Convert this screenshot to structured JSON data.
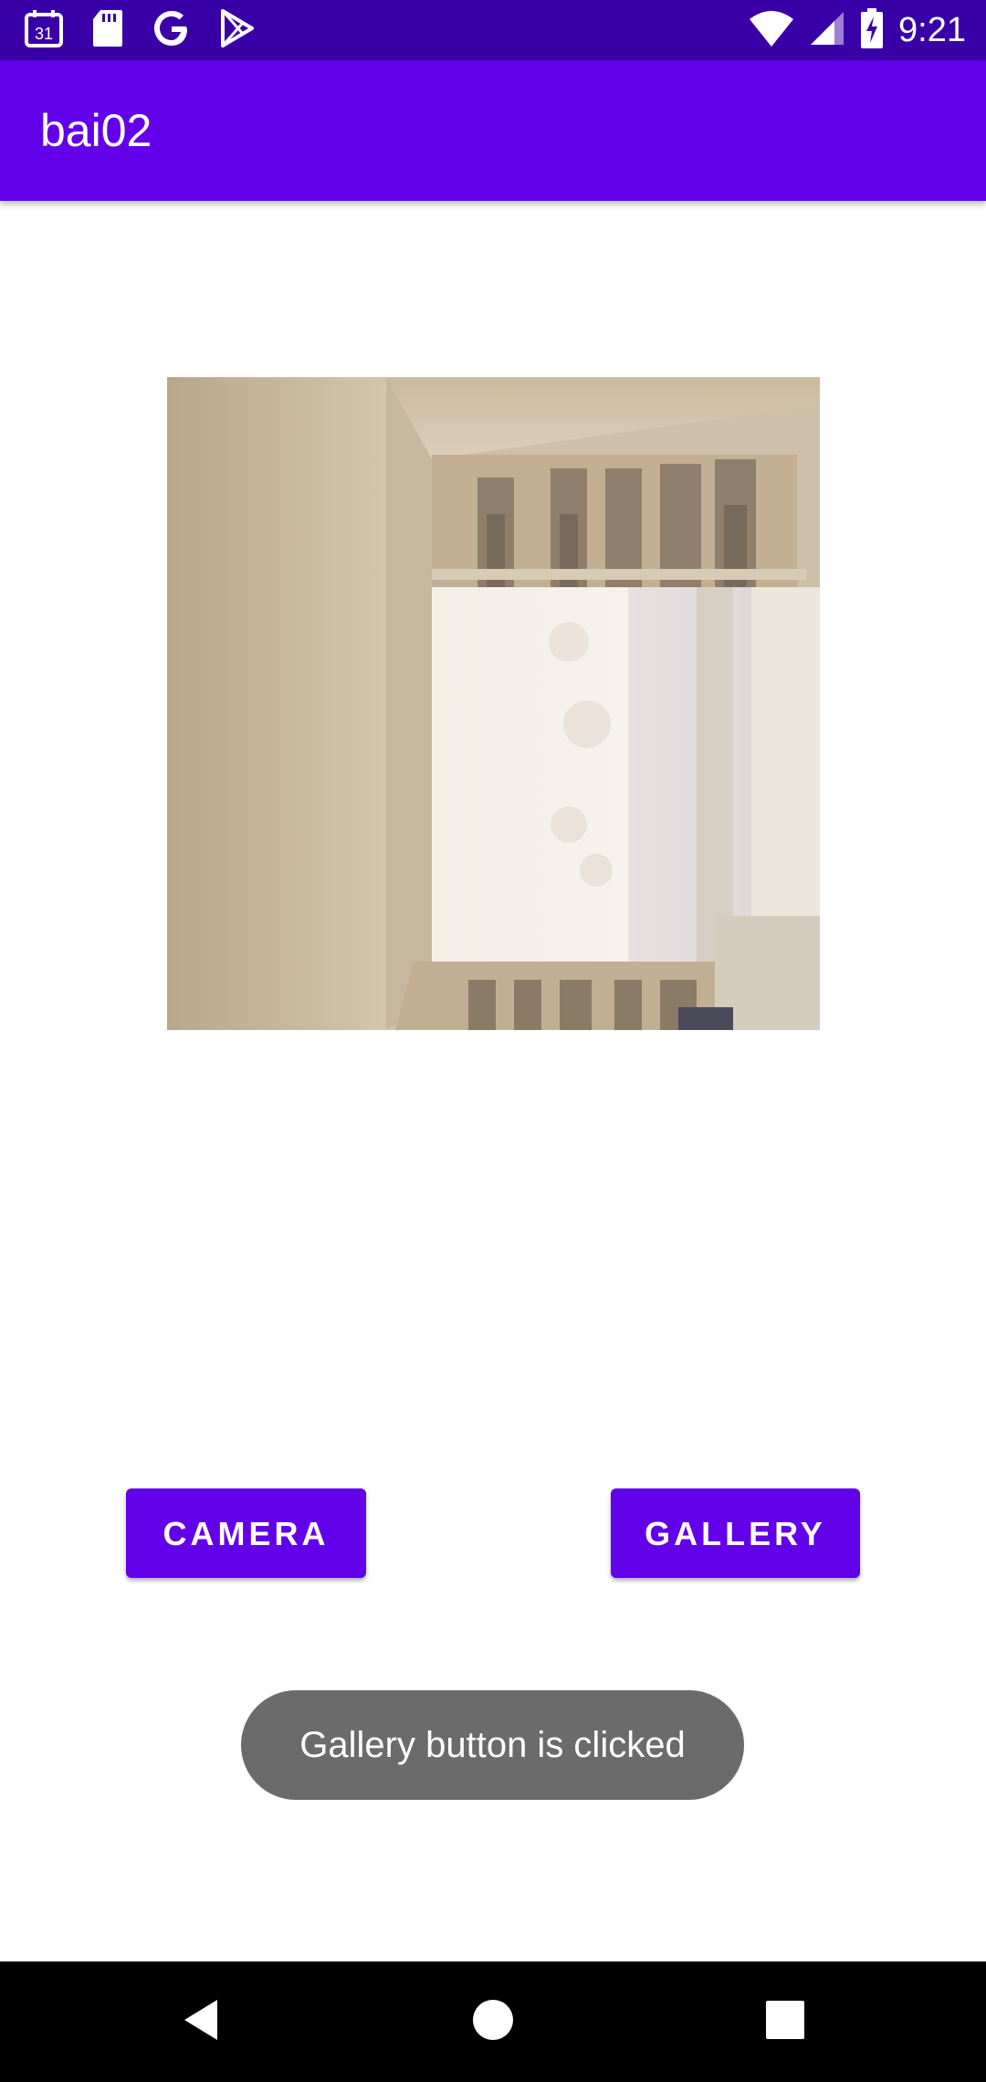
{
  "status_bar": {
    "time": "9:21",
    "calendar_day": "31",
    "icons": [
      "calendar-icon",
      "sd-card-icon",
      "google-icon",
      "play-store-icon",
      "wifi-icon",
      "signal-icon",
      "battery-charging-icon"
    ]
  },
  "app_bar": {
    "title": "bai02"
  },
  "photo": {
    "description_icon": "room-photo"
  },
  "buttons": {
    "camera": "CAMERA",
    "gallery": "GALLERY"
  },
  "toast": {
    "message": "Gallery button is clicked"
  },
  "nav_bar": {
    "icons": [
      "back-icon",
      "home-icon",
      "recents-icon"
    ]
  },
  "colors": {
    "primary": "#6200ea",
    "status_bar": "#3a00a8",
    "toast": "#6b6b6b"
  }
}
